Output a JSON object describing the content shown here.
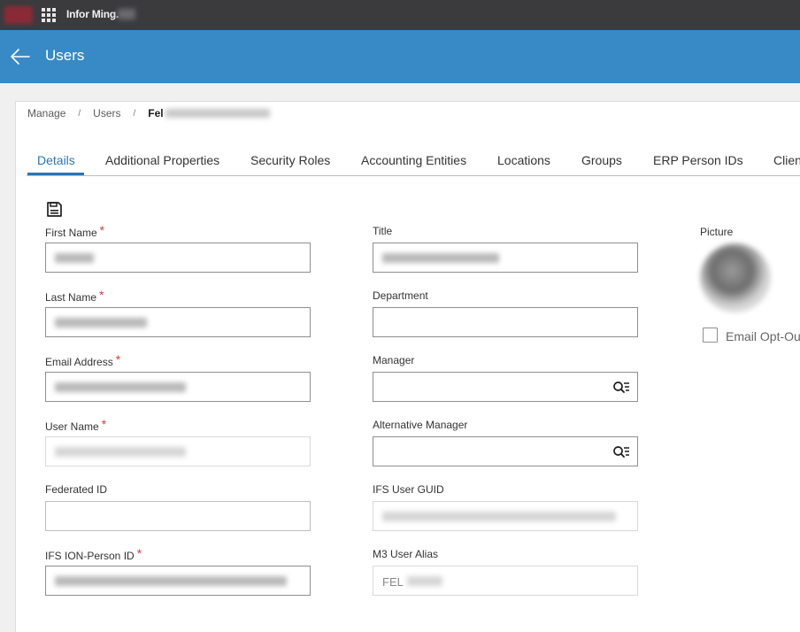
{
  "topbar": {
    "app_name": "Infor Ming."
  },
  "header": {
    "title": "Users"
  },
  "breadcrumb": {
    "items": [
      "Manage",
      "Users"
    ],
    "current": "Fel"
  },
  "tabs": [
    {
      "label": "Details",
      "active": true
    },
    {
      "label": "Additional Properties"
    },
    {
      "label": "Security Roles"
    },
    {
      "label": "Accounting Entities"
    },
    {
      "label": "Locations"
    },
    {
      "label": "Groups"
    },
    {
      "label": "ERP Person IDs"
    },
    {
      "label": "Clien"
    }
  ],
  "form": {
    "first_name_label": "First Name",
    "last_name_label": "Last Name",
    "email_label": "Email Address",
    "user_name_label": "User Name",
    "federated_id_label": "Federated ID",
    "ifs_ion_person_id_label": "IFS ION-Person ID",
    "title_label": "Title",
    "department_label": "Department",
    "manager_label": "Manager",
    "alt_manager_label": "Alternative Manager",
    "ifs_user_guid_label": "IFS User GUID",
    "m3_user_alias_label": "M3 User Alias",
    "m3_user_alias_value": "FEL",
    "required_mark": "*"
  },
  "side": {
    "picture_label": "Picture",
    "email_opt_out_label": "Email Opt-Ou"
  },
  "colors": {
    "header_blue": "#378ac6",
    "topbar_dark": "#3b3b3e",
    "accent": "#2a75b8",
    "required": "#d63b3b"
  }
}
